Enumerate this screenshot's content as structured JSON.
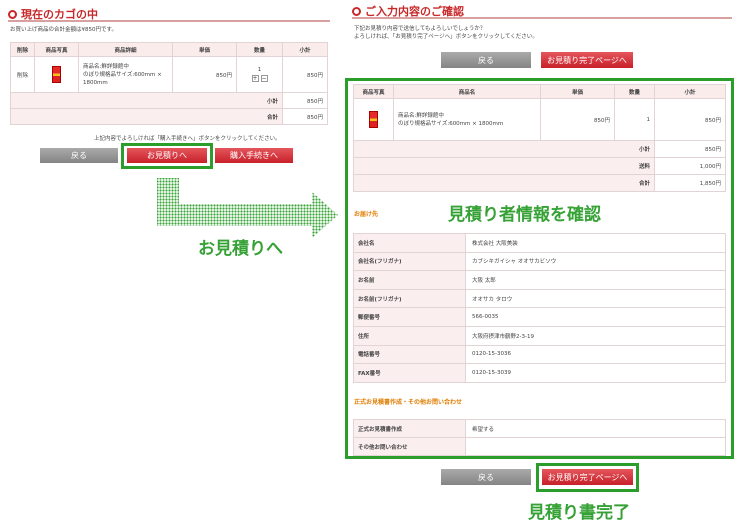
{
  "left": {
    "title": "現在のカゴの中",
    "total_note": "お買い上げ商品の合計金額は¥850円です。",
    "headers": [
      "削除",
      "商品写真",
      "商品詳細",
      "単価",
      "数量",
      "小計"
    ],
    "row": {
      "delete": "削除",
      "name": "商品名:鮮詳録館中",
      "size": "のぼり規格品サイズ:600mm × 1800mm",
      "price": "850円",
      "qty": "1",
      "subtotal": "850円"
    },
    "subtotal_label": "小計",
    "subtotal_value": "850円",
    "total_label": "合計",
    "total_value": "850円",
    "instruction": "上記内容でよろしければ「購入手続きへ」ボタンをクリックしてください。",
    "back_label": "戻る",
    "estimate_label": "お見積りへ",
    "purchase_label": "購入手続きへ"
  },
  "arrow_caption": "お見積りへ",
  "right": {
    "title": "ご入力内容のご確認",
    "note1": "下記お見積り内容で送信してもよろしいでしょうか？",
    "note2": "よろしければ、「お見積り完了ページへ」ボタンをクリックしてください。",
    "back_label": "戻る",
    "complete_label": "お見積り完了ページへ",
    "headers": [
      "商品写真",
      "商品名",
      "単価",
      "数量",
      "小計"
    ],
    "row": {
      "name": "商品名:鮮詳録館中",
      "size": "のぼり規格品サイズ:600mm × 1800mm",
      "price": "850円",
      "qty": "1",
      "subtotal": "850円"
    },
    "summary": [
      {
        "label": "小計",
        "value": "850円"
      },
      {
        "label": "送料",
        "value": "1,000円"
      },
      {
        "label": "合計",
        "value": "1,850円"
      }
    ],
    "delivery_heading": "お届け先",
    "overlay_caption": "見積り者情報を確認",
    "info": [
      {
        "label": "会社名",
        "value": "株式会社 大阪美装"
      },
      {
        "label": "会社名(フリガナ)",
        "value": "カブシキガイシャ オオサカビソウ"
      },
      {
        "label": "お名前",
        "value": "大阪 太郎"
      },
      {
        "label": "お名前(フリガナ)",
        "value": "オオサカ タロウ"
      },
      {
        "label": "郵便番号",
        "value": "566-0035"
      },
      {
        "label": "住所",
        "value": "大阪府摂津市鶴野2-3-19"
      },
      {
        "label": "電話番号",
        "value": "0120-15-3036"
      },
      {
        "label": "FAX番号",
        "value": "0120-15-3039"
      }
    ],
    "formal_heading": "正式お見積書作成・その他お問い合わせ",
    "formal": [
      {
        "label": "正式お見積書作成",
        "value": "希望する"
      },
      {
        "label": "その他お問い合わせ",
        "value": ""
      }
    ]
  },
  "bottom_caption": "見積り書完了",
  "colors": {
    "accent_red": "#c8282a",
    "green": "#2a9d2a",
    "pink": "#fbecec"
  }
}
